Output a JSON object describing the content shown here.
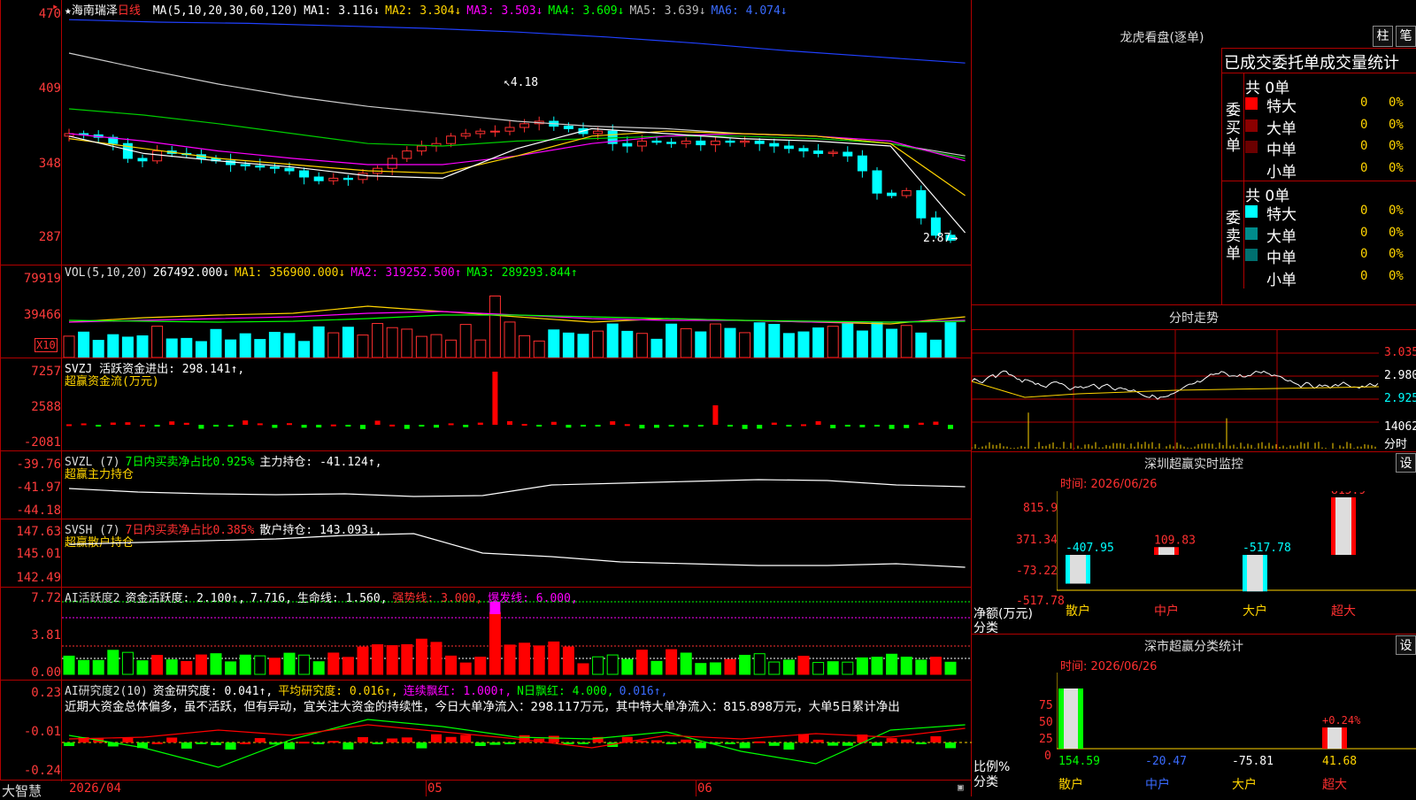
{
  "stock": {
    "star": "★",
    "name": "海南瑞泽",
    "period": "日线"
  },
  "ma_legend": [
    {
      "label": "MA(5,10,20,30,60,120)",
      "color": "#ffffff"
    },
    {
      "label": "MA1: 3.116↓",
      "color": "#ffffff"
    },
    {
      "label": "MA2: 3.304↓",
      "color": "#ffd400"
    },
    {
      "label": "MA3: 3.503↓",
      "color": "#ff00ff"
    },
    {
      "label": "MA4: 3.609↓",
      "color": "#00ff00"
    },
    {
      "label": "MA5: 3.639↓",
      "color": "#bbbbbb"
    },
    {
      "label": "MA6: 4.074↓",
      "color": "#3a6bff"
    }
  ],
  "price_axis": [
    "470",
    "409",
    "348",
    "287"
  ],
  "price_annotations": {
    "high": "4.18",
    "low": "2.87"
  },
  "vol": {
    "legend": [
      {
        "label": "VOL(5,10,20)",
        "color": "#dddddd"
      },
      {
        "label": "267492.000↓",
        "color": "#ffffff"
      },
      {
        "label": "MA1: 356900.000↓",
        "color": "#ffd400"
      },
      {
        "label": "MA2: 319252.500↑",
        "color": "#ff00ff"
      },
      {
        "label": "MA3: 289293.844↑",
        "color": "#00ff00"
      }
    ],
    "axis": [
      "79919",
      "39466"
    ],
    "unit": "X10"
  },
  "svzj": {
    "legend": [
      {
        "label": "SVZJ  活跃资金进出: 298.141↑,",
        "color": "#ffffff"
      }
    ],
    "sub": "超赢资金流(万元)",
    "axis": [
      "7257",
      "2588",
      "-2081"
    ]
  },
  "svzl": {
    "legend": [
      {
        "label": "SVZL (7)",
        "color": "#dddddd"
      },
      {
        "label": "7日内买卖净占比0.925%",
        "color": "#00ff00"
      },
      {
        "label": "主力持仓: -41.124↑,",
        "color": "#ffffff"
      }
    ],
    "sub": "超赢主力持仓",
    "axis": [
      "-39.76",
      "-41.97",
      "-44.18"
    ]
  },
  "svsh": {
    "legend": [
      {
        "label": "SVSH (7)",
        "color": "#dddddd"
      },
      {
        "label": "7日内买卖净占比0.385%",
        "color": "#ff3030"
      },
      {
        "label": "散户持仓: 143.093↓,",
        "color": "#ffffff"
      }
    ],
    "sub": "超赢散户持仓",
    "axis": [
      "147.63",
      "145.01",
      "142.49"
    ]
  },
  "ai_active": {
    "legend": [
      {
        "label": "AI活跃度2",
        "color": "#dddddd"
      },
      {
        "label": "资金活跃度: 2.100↑,",
        "color": "#ffffff"
      },
      {
        "label": "7.716,",
        "color": "#ffffff"
      },
      {
        "label": "生命线: 1.560,",
        "color": "#ffffff"
      },
      {
        "label": "强势线: 3.000,",
        "color": "#ff3030"
      },
      {
        "label": "爆发线: 6.000,",
        "color": "#ff00ff"
      }
    ],
    "axis": [
      "7.72",
      "3.81",
      "0.00"
    ]
  },
  "ai_research": {
    "legend": [
      {
        "label": "AI研究度2(10)",
        "color": "#dddddd"
      },
      {
        "label": "资金研究度: 0.041↑,",
        "color": "#ffffff"
      },
      {
        "label": "平均研究度: 0.016↑,",
        "color": "#ffd400"
      },
      {
        "label": "连续飘红: 1.000↑,",
        "color": "#ff00ff"
      },
      {
        "label": "N日飘红: 4.000,",
        "color": "#00ff00"
      },
      {
        "label": "0.016↑,",
        "color": "#3a6bff"
      }
    ],
    "commentary": "近期大资金总体偏多，虽不活跃，但有异动，宜关注大资金的持续性，今日大单净流入：298.117万元，其中特大单净流入：815.898万元，大单5日累计净出",
    "axis": [
      "0.23",
      "-0.01",
      "-0.24"
    ]
  },
  "date_axis": {
    "brand": "大智慧",
    "start": "2026/04",
    "m05": "05",
    "m06": "06"
  },
  "lhb": {
    "title": "龙虎看盘(逐单)",
    "btn1": "柱",
    "btn2": "笔",
    "header": "已成交委托单成交量统计",
    "buy": {
      "side": "委买单",
      "total": "共 0单",
      "rows": [
        {
          "name": "特大",
          "qty": "0",
          "pct": "0%",
          "color": "#ff0000"
        },
        {
          "name": "大单",
          "qty": "0",
          "pct": "0%",
          "color": "#8b0000"
        },
        {
          "name": "中单",
          "qty": "0",
          "pct": "0%",
          "color": "#6b0000"
        },
        {
          "name": "小单",
          "qty": "0",
          "pct": "0%",
          "color": ""
        }
      ]
    },
    "sell": {
      "side": "委卖单",
      "total": "共 0单",
      "rows": [
        {
          "name": "特大",
          "qty": "0",
          "pct": "0%",
          "color": "#00ffff"
        },
        {
          "name": "大单",
          "qty": "0",
          "pct": "0%",
          "color": "#008b8b"
        },
        {
          "name": "中单",
          "qty": "0",
          "pct": "0%",
          "color": "#007070"
        },
        {
          "name": "小单",
          "qty": "0",
          "pct": "0%",
          "color": ""
        }
      ]
    }
  },
  "intraday": {
    "title": "分时走势",
    "axis": [
      "3.035",
      "2.980",
      "2.925"
    ],
    "vol_axis": [
      "14062",
      "分时"
    ]
  },
  "sz_monitor": {
    "title": "深圳超赢实时监控",
    "settings": "设",
    "time": "时间: 2026/06/26",
    "axis": [
      "815.9",
      "371.34",
      "-73.22",
      "-517.78"
    ],
    "ylabel": "净额(万元)",
    "xlabel": "分类",
    "bars": [
      {
        "cat": "散户",
        "value": "-407.95",
        "v": -407.95,
        "catColor": "#ffd400"
      },
      {
        "cat": "中户",
        "value": "109.83",
        "v": 109.83,
        "catColor": "#ff3030"
      },
      {
        "cat": "大户",
        "value": "-517.78",
        "v": -517.78,
        "catColor": "#ffd400"
      },
      {
        "cat": "超大",
        "value": "815.9",
        "v": 815.9,
        "catColor": "#ff3030"
      }
    ]
  },
  "sz_class": {
    "title": "深市超赢分类统计",
    "settings": "设",
    "time": "时间: 2026/06/26",
    "axis": [
      "75",
      "50",
      "25",
      "0"
    ],
    "ylabel": "比例%",
    "xlabel": "分类",
    "bars": [
      {
        "cat": "散户",
        "value": "154.59",
        "catColor": "#ffd400",
        "valColor": "#00ff00"
      },
      {
        "cat": "中户",
        "value": "-20.47",
        "catColor": "#3a6bff",
        "valColor": "#3a6bff"
      },
      {
        "cat": "大户",
        "value": "-75.81",
        "catColor": "#ffd400",
        "valColor": "#ffffff"
      },
      {
        "cat": "超大",
        "value": "41.68",
        "catColor": "#ff3030",
        "valColor": "#ffd400"
      }
    ],
    "annot": "+0.24%"
  }
}
